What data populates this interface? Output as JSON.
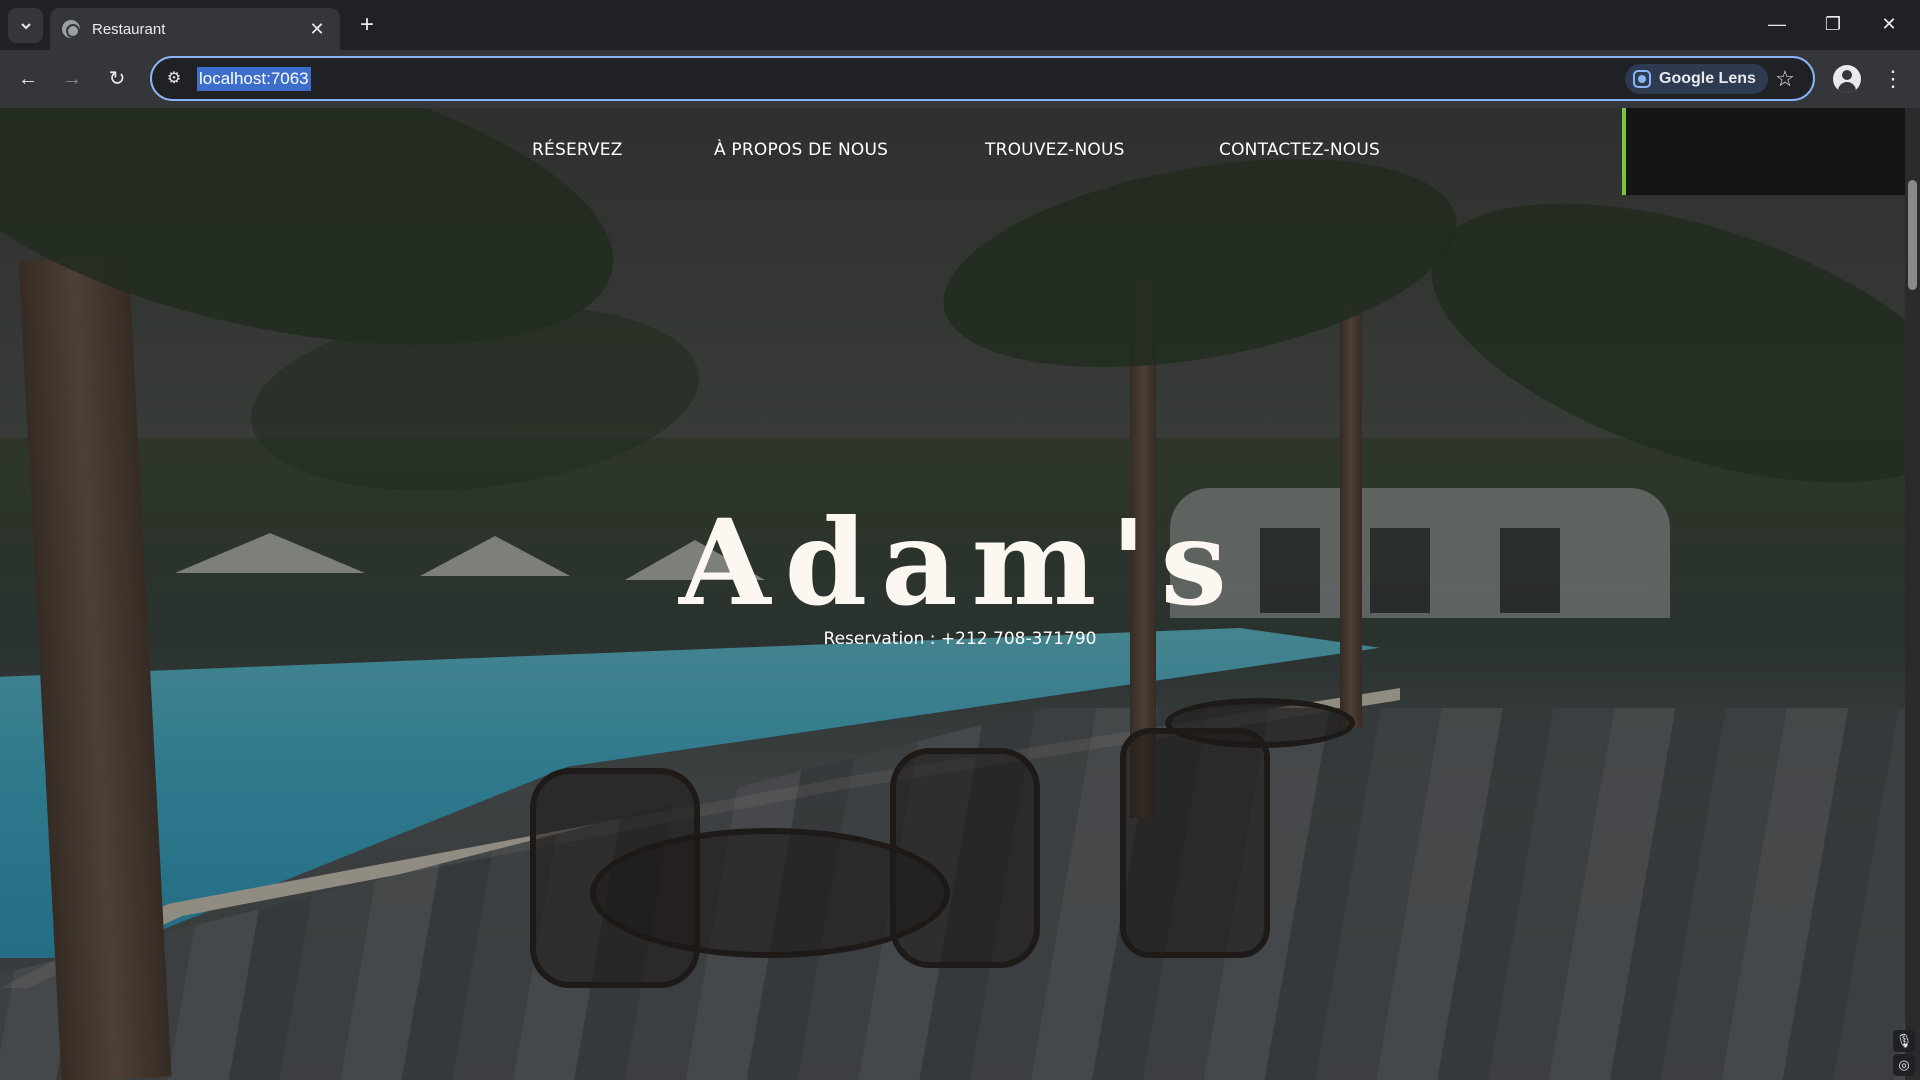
{
  "browser": {
    "tab_title": "Restaurant",
    "tab_close_icon": "close-icon",
    "new_tab_icon": "plus-icon",
    "url": "localhost:7063",
    "lens_label": "Google Lens",
    "window_controls": [
      "minimize-icon",
      "restore-icon",
      "close-icon"
    ]
  },
  "site": {
    "nav": {
      "reserve": "RÉSERVEZ",
      "about": "À PROPOS DE NOUS",
      "find": "TROUVEZ-NOUS",
      "contact": "CONTACTEZ-NOUS"
    },
    "brand": "Adam's",
    "reservation": "Reservation : +212 708-371790"
  },
  "colors": {
    "accent_bar": "#7cc43c",
    "omnibox_focus": "#8ab4f8",
    "brand_text": "#fdf7f1"
  }
}
